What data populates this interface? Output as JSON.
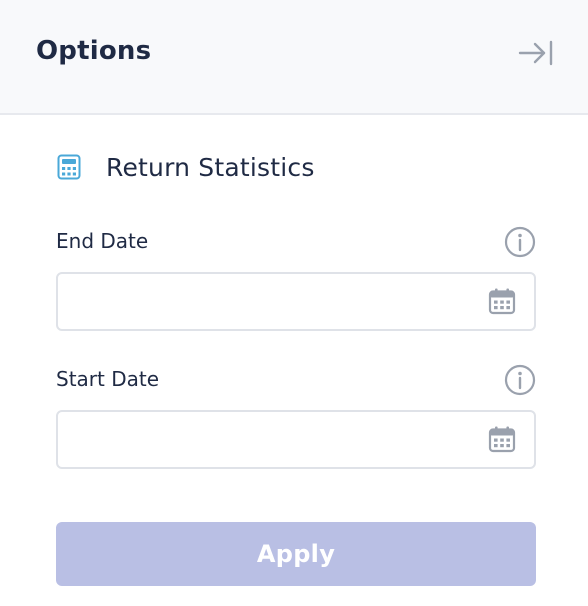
{
  "header": {
    "title": "Options",
    "collapse_icon": "collapse-right-icon"
  },
  "section": {
    "title": "Return Statistics",
    "icon": "calculator-icon",
    "icon_color": "#4aa8d8"
  },
  "fields": {
    "end_date": {
      "label": "End Date",
      "value": "",
      "placeholder": "",
      "info_icon": "info-icon",
      "picker_icon": "calendar-icon"
    },
    "start_date": {
      "label": "Start Date",
      "value": "",
      "placeholder": "",
      "info_icon": "info-icon",
      "picker_icon": "calendar-icon"
    }
  },
  "actions": {
    "apply_label": "Apply",
    "apply_color": "#b9bfe4"
  }
}
